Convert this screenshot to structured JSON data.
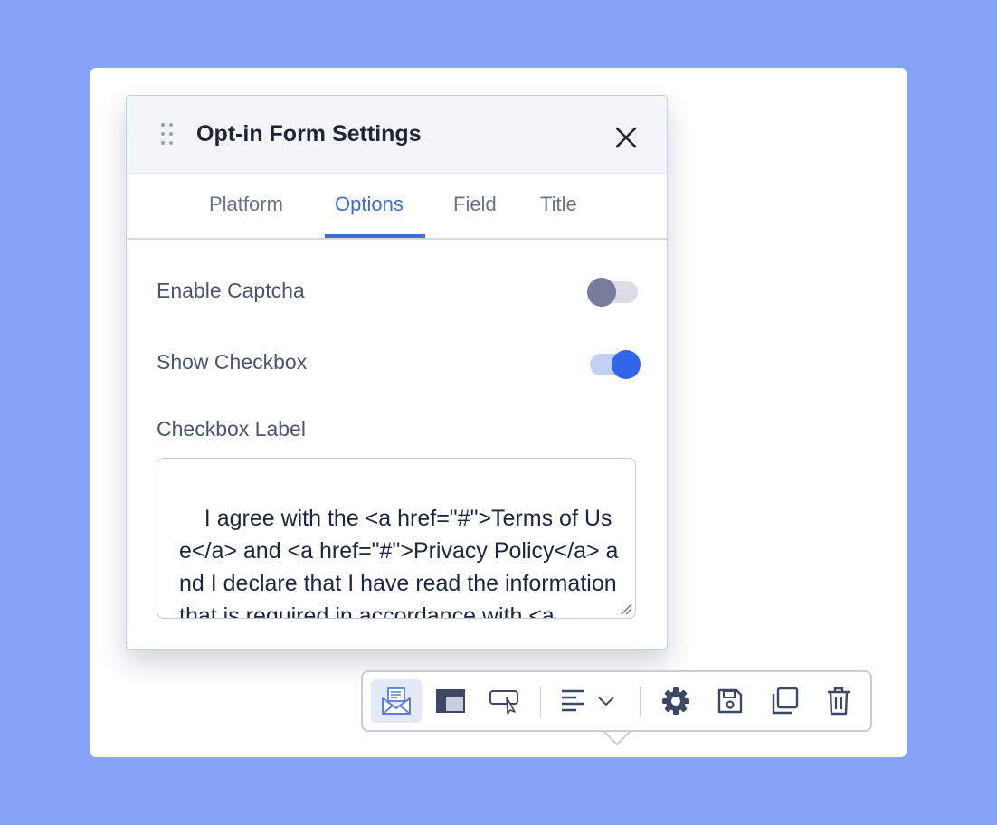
{
  "panel": {
    "title": "Opt-in Form Settings",
    "tabs": [
      {
        "label": "Platform",
        "active": false
      },
      {
        "label": "Options",
        "active": true
      },
      {
        "label": "Field",
        "active": false
      },
      {
        "label": "Title",
        "active": false
      }
    ]
  },
  "options": {
    "enable_captcha": {
      "label": "Enable Captcha",
      "enabled": false
    },
    "show_checkbox": {
      "label": "Show Checkbox",
      "enabled": true
    },
    "checkbox_label": {
      "label": "Checkbox Label",
      "value": "I agree with the <a href=\"#\">Terms of Use</a> and <a href=\"#\">Privacy Policy</a> and I declare that I have read the information that is required in accordance with <a"
    }
  },
  "toolbar": {
    "buttons": [
      {
        "icon": "envelope-form-icon",
        "active": true
      },
      {
        "icon": "layout-icon",
        "active": false
      },
      {
        "icon": "button-cursor-icon",
        "active": false
      },
      {
        "icon": "align-left-icon",
        "active": false
      },
      {
        "icon": "gear-icon",
        "active": false
      },
      {
        "icon": "save-icon",
        "active": false
      },
      {
        "icon": "duplicate-icon",
        "active": false
      },
      {
        "icon": "trash-icon",
        "active": false
      }
    ]
  },
  "colors": {
    "background": "#87a3f6",
    "accent": "#3d6fd0",
    "toggle_on": "#2f66ea",
    "toggle_off": "#767c9a",
    "icon": "#3f4766"
  }
}
